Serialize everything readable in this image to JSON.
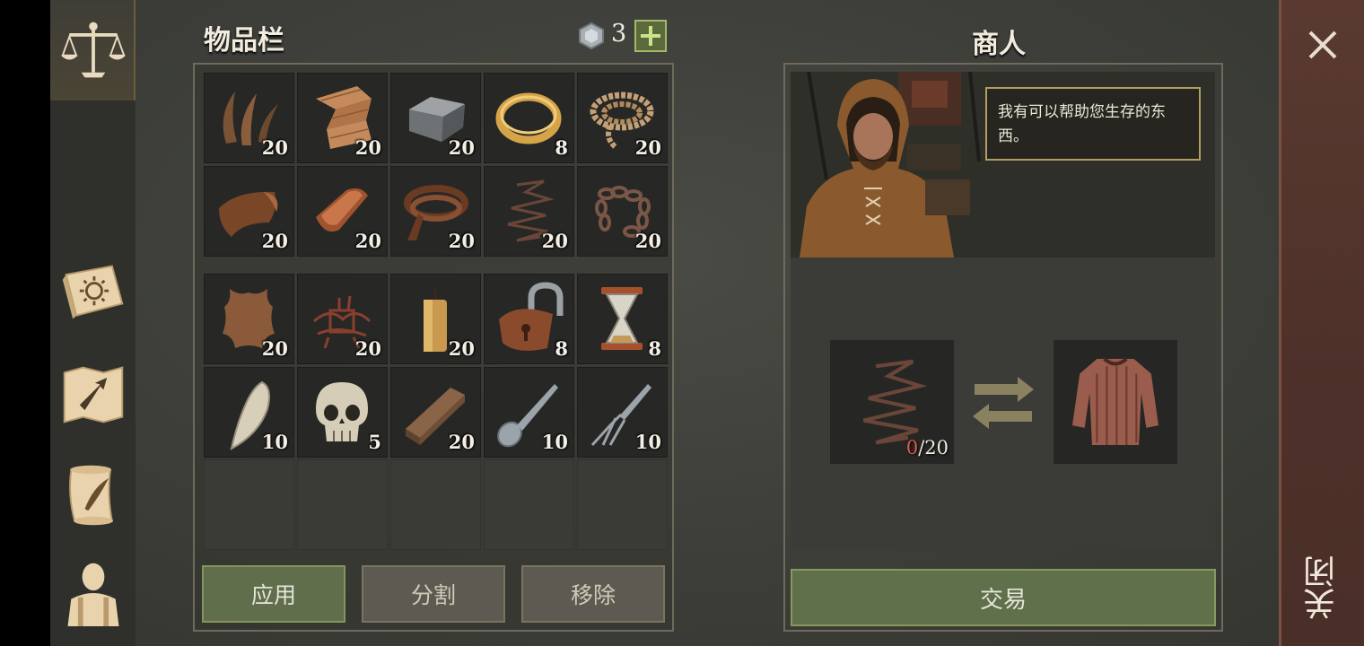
{
  "inventory": {
    "title": "物品栏",
    "currency": {
      "icon": "silver-coin-icon",
      "count": "3"
    },
    "slots_row1": [
      {
        "icon": "fiber-icon",
        "qty": "20"
      },
      {
        "icon": "cloth-icon",
        "qty": "20"
      },
      {
        "icon": "iron-ingot-icon",
        "qty": "20"
      },
      {
        "icon": "gold-ring-icon",
        "qty": "8"
      },
      {
        "icon": "rope-icon",
        "qty": "20"
      }
    ],
    "slots_row2": [
      {
        "icon": "leather-icon",
        "qty": "20"
      },
      {
        "icon": "copper-ingot-icon",
        "qty": "20"
      },
      {
        "icon": "leather-strap-icon",
        "qty": "20"
      },
      {
        "icon": "wire-icon",
        "qty": "20"
      },
      {
        "icon": "chain-icon",
        "qty": "20"
      }
    ],
    "slots_row3": [
      {
        "icon": "hide-icon",
        "qty": "20"
      },
      {
        "icon": "chainmail-scraps-icon",
        "qty": "20"
      },
      {
        "icon": "candle-icon",
        "qty": "20"
      },
      {
        "icon": "padlock-icon",
        "qty": "8"
      },
      {
        "icon": "hourglass-icon",
        "qty": "8"
      }
    ],
    "slots_row4": [
      {
        "icon": "fang-icon",
        "qty": "10"
      },
      {
        "icon": "skull-icon",
        "qty": "5"
      },
      {
        "icon": "wood-plank-icon",
        "qty": "20"
      },
      {
        "icon": "spoon-icon",
        "qty": "10"
      },
      {
        "icon": "fork-icon",
        "qty": "10"
      }
    ],
    "buttons": {
      "apply": "应用",
      "split": "分割",
      "remove": "移除"
    }
  },
  "merchant": {
    "title": "商人",
    "speech": "我有可以帮助您生存的东西。",
    "offer_item": {
      "icon": "wire-icon",
      "current": "0",
      "total": "/20"
    },
    "reward_item": {
      "icon": "chainmail-shirt-icon"
    },
    "trade_button": "交易"
  },
  "close_label": "关闭",
  "colors": {
    "accent_green": "#606e4c",
    "close_strip": "#4d3029",
    "frame": "#6e6a5c",
    "speech_border": "#b49d62"
  }
}
